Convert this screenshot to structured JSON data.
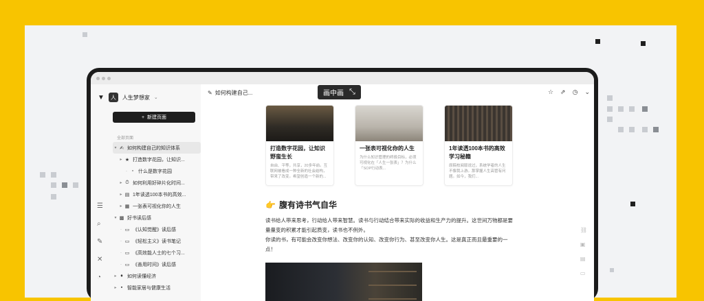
{
  "app": {
    "workspace_name": "人生梦想家",
    "workspace_avatar": "人"
  },
  "sidebar": {
    "new_page_label": "新建页面",
    "section_label": "全部页面",
    "items": [
      {
        "label": "如何构建自己的知识体系",
        "icon": "✍"
      },
      {
        "label": "打造数字花园，让知识...",
        "icon": "★"
      },
      {
        "label": "什么是数字花园",
        "icon": "▫"
      },
      {
        "label": "如何利用好碎片化时间...",
        "icon": "⏱"
      },
      {
        "label": "1年读透100本书的高效...",
        "icon": "▤"
      },
      {
        "label": "一张表可视化你的人生",
        "icon": "▦"
      },
      {
        "label": "好书读后感",
        "icon": "▩"
      },
      {
        "label": "《认知觉醒》读后感",
        "icon": "▭"
      },
      {
        "label": "《轻松主义》读书笔记",
        "icon": "▭"
      },
      {
        "label": "《高效能人士的七个习...",
        "icon": "▭"
      },
      {
        "label": "《善用时间》读后感",
        "icon": "▭"
      },
      {
        "label": "如何读懂经济",
        "icon": "♦"
      },
      {
        "label": "智能家居与健康生活",
        "icon": "▪"
      }
    ]
  },
  "topbar": {
    "breadcrumb": "如何构建自己...",
    "pip_label": "画中画"
  },
  "cards": [
    {
      "title": "打造数字花园，让知识野蛮生长",
      "desc": "自由、平等，共享，20多年前。互联网被看成一种全新的社会结构，带来了改变。希望创造一个新的..."
    },
    {
      "title": "一张表可视化你的人生",
      "desc": "为什么知识管理的终极目标，必须可视化在「人生一张表」？为什么「SOP行动表..."
    },
    {
      "title": "1年读透100本书的高效学习秘籍",
      "desc": "原稿校阅版说过，系统学者的人生不像我上游。那掌握人生高管有问题。如今，我们..."
    }
  ],
  "section": {
    "emoji": "👉",
    "heading": "腹有诗书气自华",
    "paragraph1": "读书给人带来思考，行动给人带来智慧。读书与行动结合带来实际的收益和生产力的提升。这世间万物都是要量量变的积累才能引起质变，读书也不例外。",
    "paragraph2": "你读的书，有可能会改变你想法、改变你的认知、改变你行为、甚至改变你人生。这是真正而且最重要的一点！"
  }
}
